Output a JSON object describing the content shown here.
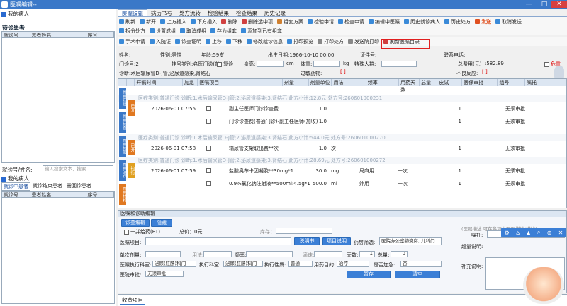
{
  "window": {
    "title": "医嘱编辑--",
    "controls": [
      "—",
      "□",
      "✕"
    ]
  },
  "left": {
    "my_patients": "我的病人",
    "waiting_title": "待诊患者",
    "waiting_cols": [
      "就诊号",
      "患者姓名",
      "序号"
    ],
    "search_label": "就诊号/姓名:",
    "search_placeholder": "输入搜索文本，搜索...",
    "my_patients2": "我的病人",
    "tabs": [
      "就诊中患者",
      "就诊结束患者",
      "需回诊患者"
    ],
    "grid_cols": [
      "就诊号",
      "患者姓名",
      "序号"
    ]
  },
  "tabs": [
    "医嘱编辑",
    "病历书写",
    "处方流转",
    "检验结果",
    "检查结果",
    "历史记录"
  ],
  "toolbar1": [
    {
      "l": "刷新",
      "c": "#3a8ad8"
    },
    {
      "l": "新开",
      "c": "#3a8ad8"
    },
    {
      "l": "上方插入",
      "c": "#3a8ad8"
    },
    {
      "l": "下方插入",
      "c": "#3a8ad8"
    },
    {
      "l": "删除",
      "c": "#d04040"
    },
    {
      "l": "删除选中项",
      "c": "#d04040"
    },
    {
      "l": "组套方案",
      "c": "#d08030"
    },
    {
      "l": "检验申请",
      "c": "#3a8ad8"
    },
    {
      "l": "检查申请",
      "c": "#3a8ad8"
    },
    {
      "l": "编辑中医嘱",
      "c": "#3a8ad8"
    },
    {
      "l": "历史就诊病人",
      "c": "#3a8ad8"
    },
    {
      "l": "历史处方",
      "c": "#3a8ad8"
    },
    {
      "l": "发送",
      "c": "#e05020"
    },
    {
      "l": "取消发送",
      "c": "#3a8ad8"
    }
  ],
  "toolbar2": [
    {
      "l": "拆分处方",
      "c": "#3a8ad8"
    },
    {
      "l": "设置成组",
      "c": "#3a8ad8"
    },
    {
      "l": "取消成组",
      "c": "#3a8ad8"
    },
    {
      "l": "存为组套",
      "c": "#3a8ad8"
    },
    {
      "l": "添加到已有组套",
      "c": "#3a8ad8"
    }
  ],
  "toolbar3": [
    {
      "l": "手术申请",
      "c": "#3a8ad8"
    },
    {
      "l": "入院证",
      "c": "#3a8ad8"
    },
    {
      "l": "诊查证明",
      "c": "#3a8ad8"
    },
    {
      "l": "上移",
      "c": "#3a8ad8"
    },
    {
      "l": "下移",
      "c": "#3a8ad8"
    },
    {
      "l": "修改就诊信息",
      "c": "#3a8ad8"
    },
    {
      "l": "打印预览",
      "c": "#3a8ad8"
    },
    {
      "l": "打印处方",
      "c": "#888"
    },
    {
      "l": "发送院打印",
      "c": "#888"
    },
    {
      "l": "刷新医嘱目录",
      "c": "#d04040"
    }
  ],
  "patient": {
    "name_label": "姓名:",
    "sex": "性别:男性",
    "age": "年龄:59岁",
    "birth": "出生日期:1966-10-10 00:00",
    "idno": "证件号:",
    "contact": "联系电话:",
    "visit_label": "门诊号:2",
    "reg_type": "挂号类别:名医门诊(普",
    "recheck": "复诊",
    "height_label": "身高:",
    "height_unit": "cm",
    "weight_label": "体重:",
    "weight_unit": "kg",
    "special_label": "特殊人群:",
    "total_label": "总费用(元)",
    "total": ":582.89",
    "critical": "危重",
    "diagnosis": "诊断:术后输尿管D-J管,泌尿道感染,肾结石",
    "allergy": "过敏药物:",
    "adverse": "不良反应:"
  },
  "grid": {
    "cols": [
      "开嘱时间",
      "加急",
      "医嘱项目",
      "剂量",
      "剂量单位",
      "用法",
      "频率",
      "用药天数",
      "总量",
      "皮试",
      "医保审批",
      "组号",
      "嘱托"
    ],
    "cats": [
      "医疗类别:普通门诊  诊断:1.术后输尿管D-J管;2.泌尿道感染;3.肾结石  此方小计:12.8元  处方号:260601000231",
      "医疗类别:普通门诊  诊断:1.术后输尿管D-J管;2.泌尿道感染;3.肾结石  此方小计:544.0元  处方号:260601000270",
      "医疗类别:普通门诊  诊断:1.术后输尿管D-J管;2.泌尿道感染;3.肾结石  此方小计:28.69元  处方号:260601000272"
    ],
    "rows": [
      {
        "time": "2026-06-01 07:55",
        "item": "副主任医师门诊诊查费",
        "dose": "1.0",
        "qty": "1",
        "appr": "无须审批",
        "status": "已开"
      },
      {
        "time": "",
        "item": "门诊诊查费(普通门诊)-副主任医师(加收)",
        "dose": "1.0",
        "qty": "1",
        "appr": "无须审批",
        "status": ""
      },
      {
        "time": "2026-06-01 07:58",
        "item": "输尿管支架取出费**次",
        "dose": "1.0",
        "unit": "次",
        "qty": "1",
        "appr": "无须审批",
        "status": "已开"
      },
      {
        "time": "2026-06-01 07:59",
        "item": "盐酸奥布卡因凝胶**30mg*1",
        "dose": "30.0",
        "unit": "mg",
        "usage": "局麻用",
        "freq": "一次",
        "qty": "1",
        "appr": "无须审批",
        "status": "执行"
      },
      {
        "time": "",
        "item": "0.9%氯化钠注射液**500ml:4.5g*1",
        "dose": "500.0",
        "unit": "ml",
        "usage": "外用",
        "freq": "一次",
        "qty": "1",
        "appr": "无须审批",
        "status": ""
      }
    ],
    "side": [
      "常用药组",
      "常用检查",
      "常用检验",
      "常用治疗",
      "常用材料"
    ]
  },
  "editor": {
    "title": "医嘱和诊断编辑",
    "btn_edit": "诊查编辑",
    "btn_hide": "隐藏",
    "onekey": "一并给药(F1)",
    "total": "总价：0元",
    "send_label": "库存：",
    "item_label": "医嘱项目:",
    "btn_desc": "说明书",
    "btn_item": "项目说明",
    "pharm_label": "药房筛选:",
    "pharm": "医院办公室物资房, 儿科门...",
    "single_label": "单次剂量:",
    "usage_label": "用法:",
    "freq_label": "频率:",
    "drip_label": "滴速:",
    "days_label": "天数:",
    "days": "1",
    "total_label": "总量:",
    "total_v": "0",
    "exec_dept_label": "医嘱执行科室:",
    "exec_dept": "泌尿(肛肠)科门",
    "exec2_label": "执行科室:",
    "exec2": "泌尿(肛肠)科门",
    "exec_prop_label": "执行性质:",
    "exec_prop": "普通",
    "purpose_label": "用药目的:",
    "purpose": "治疗",
    "urgent_label": "是否加急:",
    "urgent": "否",
    "appr_label": "医院审批:",
    "appr": "无须审批",
    "btn_save": "暂存",
    "btn_clear": "清空",
    "note_label": "嘱托:",
    "bottom_tab": "收费项目",
    "notice": "(医嘱描述 可在各项中医嘱描述/描述)",
    "dose_note_label": "超量说明:",
    "extra_label": "补充说明:"
  }
}
